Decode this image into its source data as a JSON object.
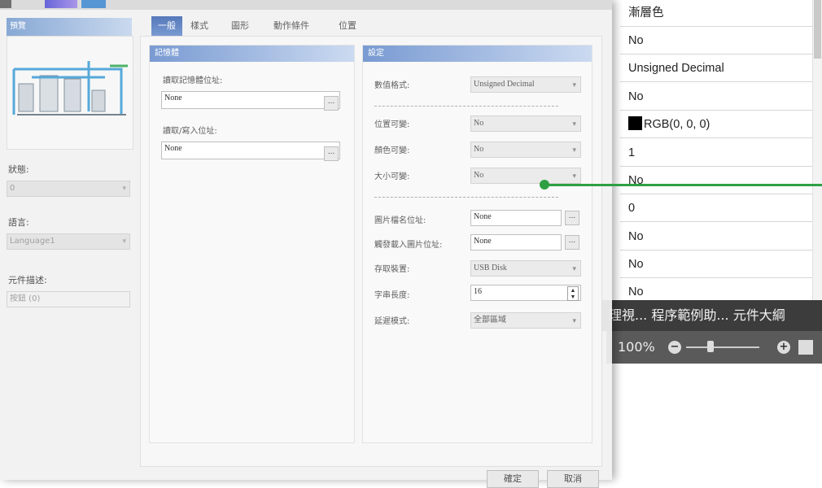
{
  "property_grid": {
    "rows": [
      {
        "value": "漸層色"
      },
      {
        "value": "No"
      },
      {
        "value": "Unsigned Decimal"
      },
      {
        "value": "No"
      },
      {
        "value": "RGB(0, 0, 0)",
        "swatch": "#000000"
      },
      {
        "value": "1"
      },
      {
        "value": "No"
      },
      {
        "value": "0"
      },
      {
        "value": "No"
      },
      {
        "value": "No"
      },
      {
        "value": "No"
      }
    ]
  },
  "bottom_tabs": "理視... 程序範例助... 元件大綱",
  "status": {
    "zoom": "100%",
    "zoom_out_icon": "minus-icon",
    "zoom_in_icon": "plus-icon"
  },
  "dialog": {
    "left": {
      "header": "預覽",
      "state_label": "狀態:",
      "state_value": "0",
      "language_label": "語言:",
      "language_value": "Language1",
      "desc_label": "元件描述:",
      "desc_value": "按鈕 (0)"
    },
    "tabs": [
      "一般",
      "樣式",
      "圖形",
      "動作條件",
      "位置"
    ],
    "memory_group": {
      "title": "記憶體",
      "read_label": "讀取記憶體位址:",
      "read_value": "None",
      "write_label": "讀取/寫入位址:",
      "write_value": "None",
      "dots": "..."
    },
    "settings_group": {
      "title": "設定",
      "format_label": "數值格式:",
      "format_value": "Unsigned Decimal",
      "pos_var_label": "位置可變:",
      "pos_var_value": "No",
      "color_var_label": "顏色可變:",
      "color_var_value": "No",
      "size_var_label": "大小可變:",
      "size_var_value": "No",
      "img_name_label": "圖片檔名位址:",
      "img_name_value": "None",
      "trigger_label": "觸發載入圖片位址:",
      "trigger_value": "None",
      "storage_label": "存取裝置:",
      "storage_value": "USB Disk",
      "strlen_label": "字串長度:",
      "strlen_value": "16",
      "display_label": "延遲模式:",
      "display_value": "全部區域",
      "dots": "..."
    },
    "buttons": {
      "ok": "確定",
      "cancel": "取消"
    }
  },
  "colors": {
    "accent": "#4a6fb5",
    "connector": "#2ea043",
    "statusbar": "#5a5a5a"
  }
}
